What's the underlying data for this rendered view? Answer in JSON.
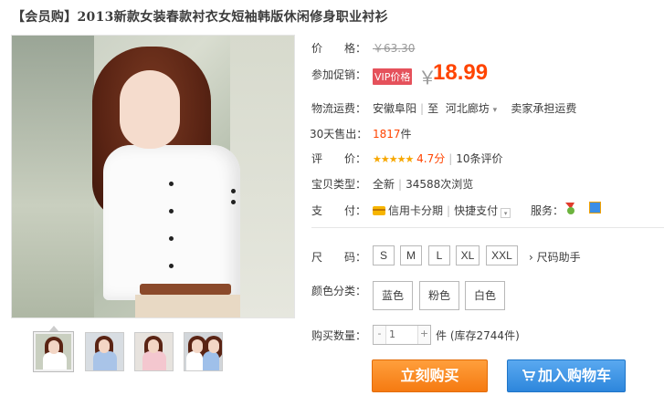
{
  "product": {
    "title": "【会员购】2013新款女装春款衬衣女短袖韩版休闲修身职业衬衫"
  },
  "price": {
    "label": "价　　格：",
    "original": "￥63.30",
    "promo_label": "参加促销：",
    "promo_tag": "VIP价格",
    "yen": "￥",
    "promo_price": "18.99"
  },
  "shipping": {
    "label": "物流运费：",
    "from": "安徽阜阳",
    "to_prefix": "至",
    "to": "河北廊坊",
    "dropdown": "▾",
    "fee": "卖家承担运费"
  },
  "sales": {
    "label": "30天售出：",
    "count": "1817",
    "unit": "件"
  },
  "rating": {
    "label": "评　　价：",
    "stars": "★★★★★",
    "score": "4.7分",
    "reviews": "10条评价"
  },
  "item_type": {
    "label": "宝贝类型：",
    "condition": "全新",
    "views": "34588次浏览"
  },
  "payment": {
    "label": "支　　付：",
    "credit": "信用卡分期",
    "quick": "快捷支付",
    "service_label": "服务："
  },
  "size": {
    "label": "尺　　码：",
    "options": [
      "S",
      "M",
      "L",
      "XL",
      "XXL"
    ],
    "helper": "尺码助手",
    "helper_arrow": "›"
  },
  "color": {
    "label": "颜色分类：",
    "options": [
      "蓝色",
      "粉色",
      "白色"
    ]
  },
  "quantity": {
    "label": "购买数量：",
    "minus": "-",
    "value": "1",
    "plus": "+",
    "unit": "件",
    "stock": "(库存2744件)"
  },
  "actions": {
    "buy_now": "立刻购买",
    "add_cart": "加入购物车",
    "cart_icon": "shopping-cart-icon"
  },
  "colors": {
    "accent": "#ff4400",
    "vip_tag": "#e5515b",
    "buy_button": "#f57a11",
    "cart_button": "#2d86dc",
    "stars": "#f7a700"
  }
}
